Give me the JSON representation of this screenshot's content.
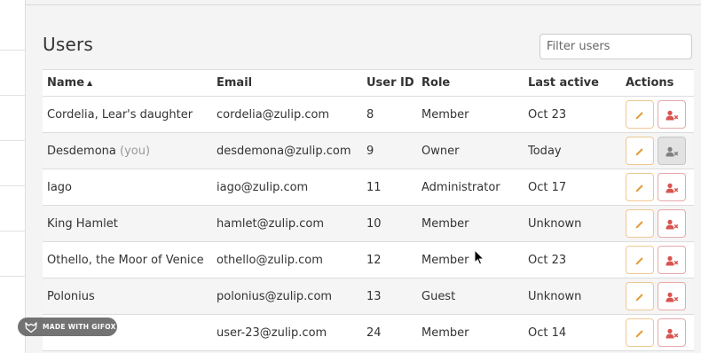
{
  "page": {
    "title": "Users"
  },
  "filter": {
    "placeholder": "Filter users",
    "value": ""
  },
  "table": {
    "headers": {
      "name": "Name",
      "email": "Email",
      "user_id": "User ID",
      "role": "Role",
      "last_active": "Last active",
      "actions": "Actions"
    },
    "sort": {
      "column": "name",
      "direction": "ascending"
    },
    "rows": [
      {
        "name": "Cordelia, Lear's daughter",
        "you": "",
        "email": "cordelia@zulip.com",
        "user_id": "8",
        "role": "Member",
        "last_active": "Oct 23",
        "deactivate_disabled": false
      },
      {
        "name": "Desdemona",
        "you": "(you)",
        "email": "desdemona@zulip.com",
        "user_id": "9",
        "role": "Owner",
        "last_active": "Today",
        "deactivate_disabled": true
      },
      {
        "name": "Iago",
        "you": "",
        "email": "iago@zulip.com",
        "user_id": "11",
        "role": "Administrator",
        "last_active": "Oct 17",
        "deactivate_disabled": false
      },
      {
        "name": "King Hamlet",
        "you": "",
        "email": "hamlet@zulip.com",
        "user_id": "10",
        "role": "Member",
        "last_active": "Unknown",
        "deactivate_disabled": false
      },
      {
        "name": "Othello, the Moor of Venice",
        "you": "",
        "email": "othello@zulip.com",
        "user_id": "12",
        "role": "Member",
        "last_active": "Oct 23",
        "deactivate_disabled": false
      },
      {
        "name": "Polonius",
        "you": "",
        "email": "polonius@zulip.com",
        "user_id": "13",
        "role": "Guest",
        "last_active": "Unknown",
        "deactivate_disabled": false
      },
      {
        "name": "",
        "you": "",
        "email": "user-23@zulip.com",
        "user_id": "24",
        "role": "Member",
        "last_active": "Oct 14",
        "deactivate_disabled": false
      }
    ]
  },
  "icons": {
    "sort": "caret-up-icon",
    "edit": "pencil-icon",
    "deactivate": "user-times-icon"
  },
  "colors": {
    "edit_icon": "#e39e3a",
    "deactivate_icon": "#d9534f",
    "disabled_icon": "#808080"
  },
  "watermark": {
    "text": "MADE WITH GIFOX"
  }
}
